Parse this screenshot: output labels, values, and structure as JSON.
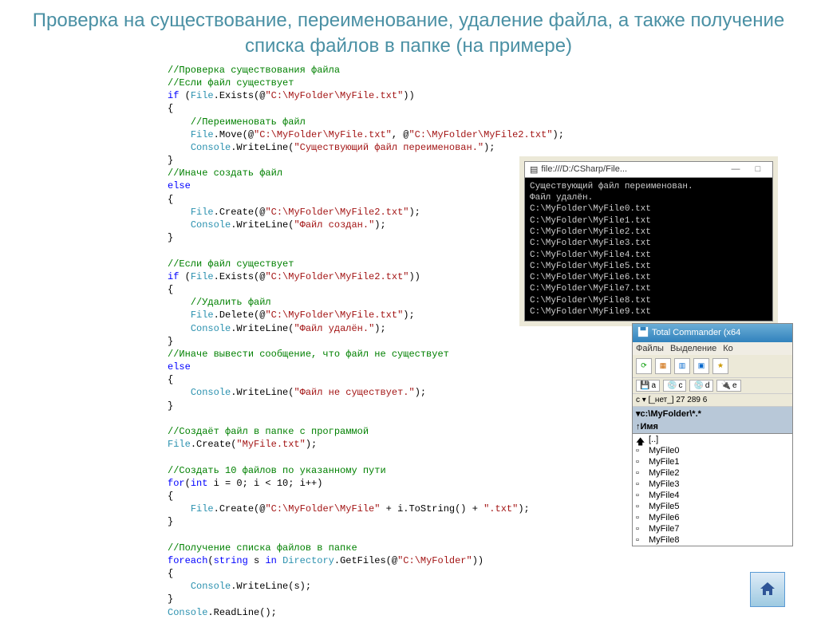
{
  "title": "Проверка на существование, переименование, удаление файла, а также получение списка файлов в папке (на примере)",
  "code": {
    "c1": "//Проверка существования файла",
    "c2": "//Если файл существует",
    "k_if": "if",
    "k_else": "else",
    "k_for": "for",
    "k_foreach": "foreach",
    "k_in": "in",
    "k_int": "int",
    "k_string": "string",
    "t_file": "File",
    "t_console": "Console",
    "t_dir": "Directory",
    "m_exists": ".Exists(@",
    "m_move": ".Move(@",
    "m_write": ".WriteLine(",
    "m_create": ".Create(@",
    "m_create2": ".Create(",
    "m_delete": ".Delete(@",
    "m_getfiles": ".GetFiles(@",
    "m_tostr": ".ToString()",
    "m_readln": ".ReadLine();",
    "s_path1": "\"C:\\MyFolder\\MyFile.txt\"",
    "s_path2": "\"C:\\MyFolder\\MyFile2.txt\"",
    "s_ren": "\"Существующий файл переименован.\"",
    "c3": "//Переименовать файл",
    "c4": "//Иначе создать файл",
    "s_created": "\"Файл создан.\"",
    "c5": "//Если файл существует",
    "c6": "//Удалить файл",
    "s_deleted": "\"Файл удалён.\"",
    "c7": "//Иначе вывести сообщение, что файл не существует",
    "s_notexist": "\"Файл не существует.\"",
    "c8": "//Создаёт файл в папке с программой",
    "s_myfile": "\"MyFile.txt\"",
    "c9": "//Создать 10 файлов по указанному пути",
    "for_expr_a": "(",
    "for_expr_b": " i = 0; i < 10; i++)",
    "s_prefix": "\"C:\\MyFolder\\MyFile\"",
    "s_ext": "\".txt\"",
    "c10": "//Получение списка файлов в папке",
    "foreach_a": "(",
    "foreach_b": " s ",
    "s_folder": "\"C:\\MyFolder\"",
    "write_s": "Console.WriteLine(s);"
  },
  "console": {
    "title": "file:///D:/CSharp/File...",
    "lines": [
      "Существующий файл переименован.",
      "Файл удалён.",
      "C:\\MyFolder\\MyFile0.txt",
      "C:\\MyFolder\\MyFile1.txt",
      "C:\\MyFolder\\MyFile2.txt",
      "C:\\MyFolder\\MyFile3.txt",
      "C:\\MyFolder\\MyFile4.txt",
      "C:\\MyFolder\\MyFile5.txt",
      "C:\\MyFolder\\MyFile6.txt",
      "C:\\MyFolder\\MyFile7.txt",
      "C:\\MyFolder\\MyFile8.txt",
      "C:\\MyFolder\\MyFile9.txt"
    ]
  },
  "tc": {
    "title": "Total Commander (x64",
    "menu": [
      "Файлы",
      "Выделение",
      "Ко"
    ],
    "drives": [
      "a",
      "c",
      "d",
      "e"
    ],
    "path": "c ▾  [_нет_]  27 289 6",
    "location": "▾c:\\MyFolder\\*.*",
    "header": "↑Имя",
    "updir": "[..]",
    "files": [
      "MyFile0",
      "MyFile1",
      "MyFile2",
      "MyFile3",
      "MyFile4",
      "MyFile5",
      "MyFile6",
      "MyFile7",
      "MyFile8"
    ]
  }
}
